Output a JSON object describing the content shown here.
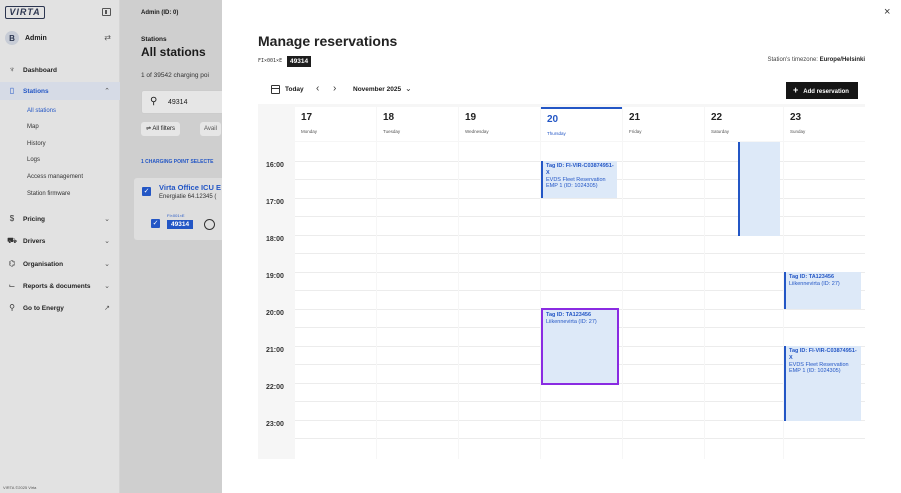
{
  "sidebar": {
    "logo": "VIRTA",
    "user": {
      "initial": "B",
      "name": "Admin"
    },
    "nav": [
      {
        "label": "Dashboard",
        "icon": "♆"
      },
      {
        "label": "Stations",
        "icon": "▯"
      },
      {
        "label": "Pricing",
        "icon": "$"
      },
      {
        "label": "Drivers",
        "icon": "⛟"
      },
      {
        "label": "Organisation",
        "icon": "⌬"
      },
      {
        "label": "Reports & documents",
        "icon": "⌙"
      },
      {
        "label": "Go to Energy",
        "icon": "⚲"
      }
    ],
    "stations_sub": [
      "All stations",
      "Map",
      "History",
      "Logs",
      "Access management",
      "Station firmware"
    ],
    "footer": "VIRTA ©2025 Virta"
  },
  "background_page": {
    "admin": "Admin (ID: 0)",
    "breadcrumb": "Stations",
    "title": "All stations",
    "count_text": "1 of 39542 charging poi",
    "search_value": "49314",
    "filter_label": "All filters",
    "avail_label": "Avail",
    "selected_text": "1 CHARGING POINT SELECTE",
    "station_name": "Virta Office ICU E",
    "station_sub": "Energiatie 64.12345 (",
    "cp_prefix": "FI×001×E",
    "cp_id": "49314"
  },
  "modal": {
    "title": "Manage reservations",
    "tag_prefix": "FI×001×E",
    "tag_id": "49314",
    "timezone_label": "Station's timezone:",
    "timezone_value": "Europe/Helsinki",
    "toolbar": {
      "today": "Today",
      "month": "November 2025",
      "add_button": "Add reservation"
    },
    "days": [
      {
        "num": "17",
        "name": "Monday"
      },
      {
        "num": "18",
        "name": "Tuesday"
      },
      {
        "num": "19",
        "name": "Wednesday"
      },
      {
        "num": "20",
        "name": "Thursday"
      },
      {
        "num": "21",
        "name": "Friday"
      },
      {
        "num": "22",
        "name": "Saturday"
      },
      {
        "num": "23",
        "name": "Sunday"
      }
    ],
    "times": [
      "16:00",
      "17:00",
      "18:00",
      "19:00",
      "20:00",
      "21:00",
      "22:00",
      "23:00"
    ],
    "events": [
      {
        "tag": "Tag ID: FI-VIR-C03874951-X",
        "desc": "EVDS Fleet Reservation EMP 1 (ID: 1024305)"
      },
      {
        "tag": "Tag ID: TA123456",
        "desc": "Liikennevirta (ID: 27)"
      },
      {
        "tag": "",
        "desc": ""
      },
      {
        "tag": "Tag ID: TA123456",
        "desc": "Liikennevirta (ID: 27)"
      },
      {
        "tag": "Tag ID: FI-VIR-C03874951-X",
        "desc": "EVDS Fleet Reservation EMP 1 (ID: 1024305)"
      }
    ]
  },
  "colors": {
    "accent": "#2356c5",
    "event_bg": "#dde9f8",
    "selected_border": "#8a2be2",
    "sidebar_bg": "#e2e2e2"
  }
}
